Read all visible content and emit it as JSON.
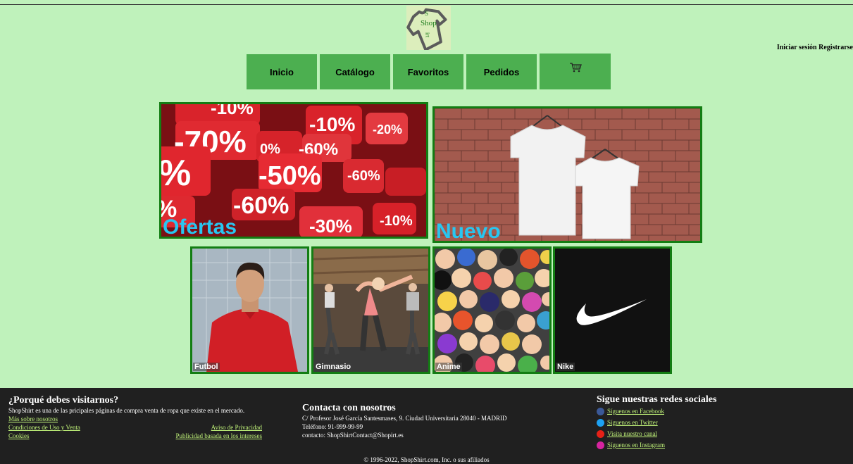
{
  "brand": {
    "logo_text_shop": "Shop",
    "logo_text_irt": "irt",
    "logo_letter_s": "S"
  },
  "auth": {
    "login": "Iniciar sesión",
    "register": "Registrarse"
  },
  "nav": {
    "items": [
      {
        "label": "Inicio"
      },
      {
        "label": "Catálogo"
      },
      {
        "label": "Favoritos"
      },
      {
        "label": "Pedidos"
      }
    ],
    "cart_icon": "cart-icon"
  },
  "banners": {
    "ofertas": "Ofertas",
    "nuevo": "Nuevo"
  },
  "categories": [
    {
      "label": "Futbol"
    },
    {
      "label": "Gimnasio"
    },
    {
      "label": "Anime"
    },
    {
      "label": "Nike"
    }
  ],
  "footer": {
    "about": {
      "title": "¿Porqué debes visitarnos?",
      "text": "ShopShirt es una de las pricipales páginas de compra venta de ropa que existe en el mercado.",
      "more_link": "Más sobre nosotros",
      "terms_link": "Condiciones de Uso y Venta",
      "privacy_link": "Aviso de Privacidad",
      "cookies_link": "Cookies",
      "ads_link": "Publicidad basada en los intereses"
    },
    "contact": {
      "title": "Contacta con nosotros",
      "address": "C/ Profesor José García Santesmases, 9. Ciudad Universitaria 28040 - MADRID",
      "phone": "Teléfono: 91-999-99-99",
      "email": "contacto: ShopShirtContact@Shopirt.es"
    },
    "social": {
      "title": "Sigue nuestras redes sociales",
      "items": [
        {
          "label": "Síguenos en Facebook",
          "icon": "facebook-icon",
          "color": "#3b5998"
        },
        {
          "label": "Síguenos en Twitter",
          "icon": "twitter-icon",
          "color": "#1da1f2"
        },
        {
          "label": "Visita nuestro canal",
          "icon": "youtube-icon",
          "color": "#e62117"
        },
        {
          "label": "Síguenos en Instagram",
          "icon": "instagram-icon",
          "color": "#d6249f"
        }
      ]
    },
    "copyright": "© 1996-2022, ShopShirt.com, Inc. o sus afiliados"
  }
}
